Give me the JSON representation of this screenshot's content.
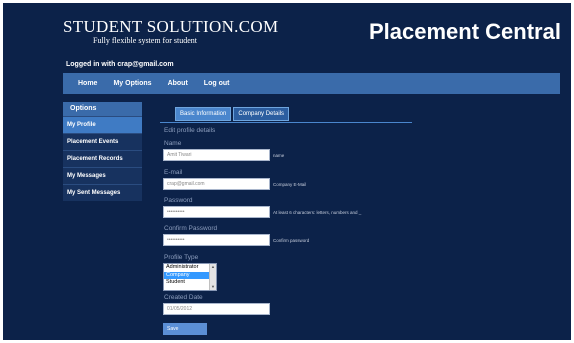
{
  "header": {
    "logo_title": "STUDENT SOLUTION.COM",
    "logo_tagline": "Fully flexible system for student",
    "brand": "Placement Central",
    "welcome": "Logged in with crap@gmail.com"
  },
  "nav": {
    "items": [
      "Home",
      "My Options",
      "About",
      "Log out"
    ]
  },
  "sidebar": {
    "heading": "Options",
    "items": [
      "My Profile",
      "Placement Events",
      "Placement Records",
      "My Messages",
      "My Sent Messages"
    ]
  },
  "tabs": [
    "Basic Information",
    "Company Details"
  ],
  "form": {
    "title": "Edit profile details",
    "name": {
      "label": "Name",
      "value": "Amit Tiwari",
      "hint": "name"
    },
    "email": {
      "label": "E-mail",
      "value": "crap@gmail.com",
      "hint": "Company E-Mail"
    },
    "password": {
      "label": "Password",
      "value": "••••••••••",
      "hint": "At least 6 characters: letters, numbers and _"
    },
    "confirm": {
      "label": "Confirm Password",
      "value": "••••••••••",
      "hint": "Confirm password"
    },
    "profile_type": {
      "label": "Profile Type",
      "options": [
        "Administrator",
        "Company",
        "Student"
      ],
      "selected": "Company"
    },
    "created": {
      "label": "Created Date",
      "value": "01/05/2012"
    },
    "save_label": "Save"
  },
  "colors": {
    "background": "#0c2249",
    "nav": "#3a6baa",
    "active": "#3f7bc4"
  }
}
